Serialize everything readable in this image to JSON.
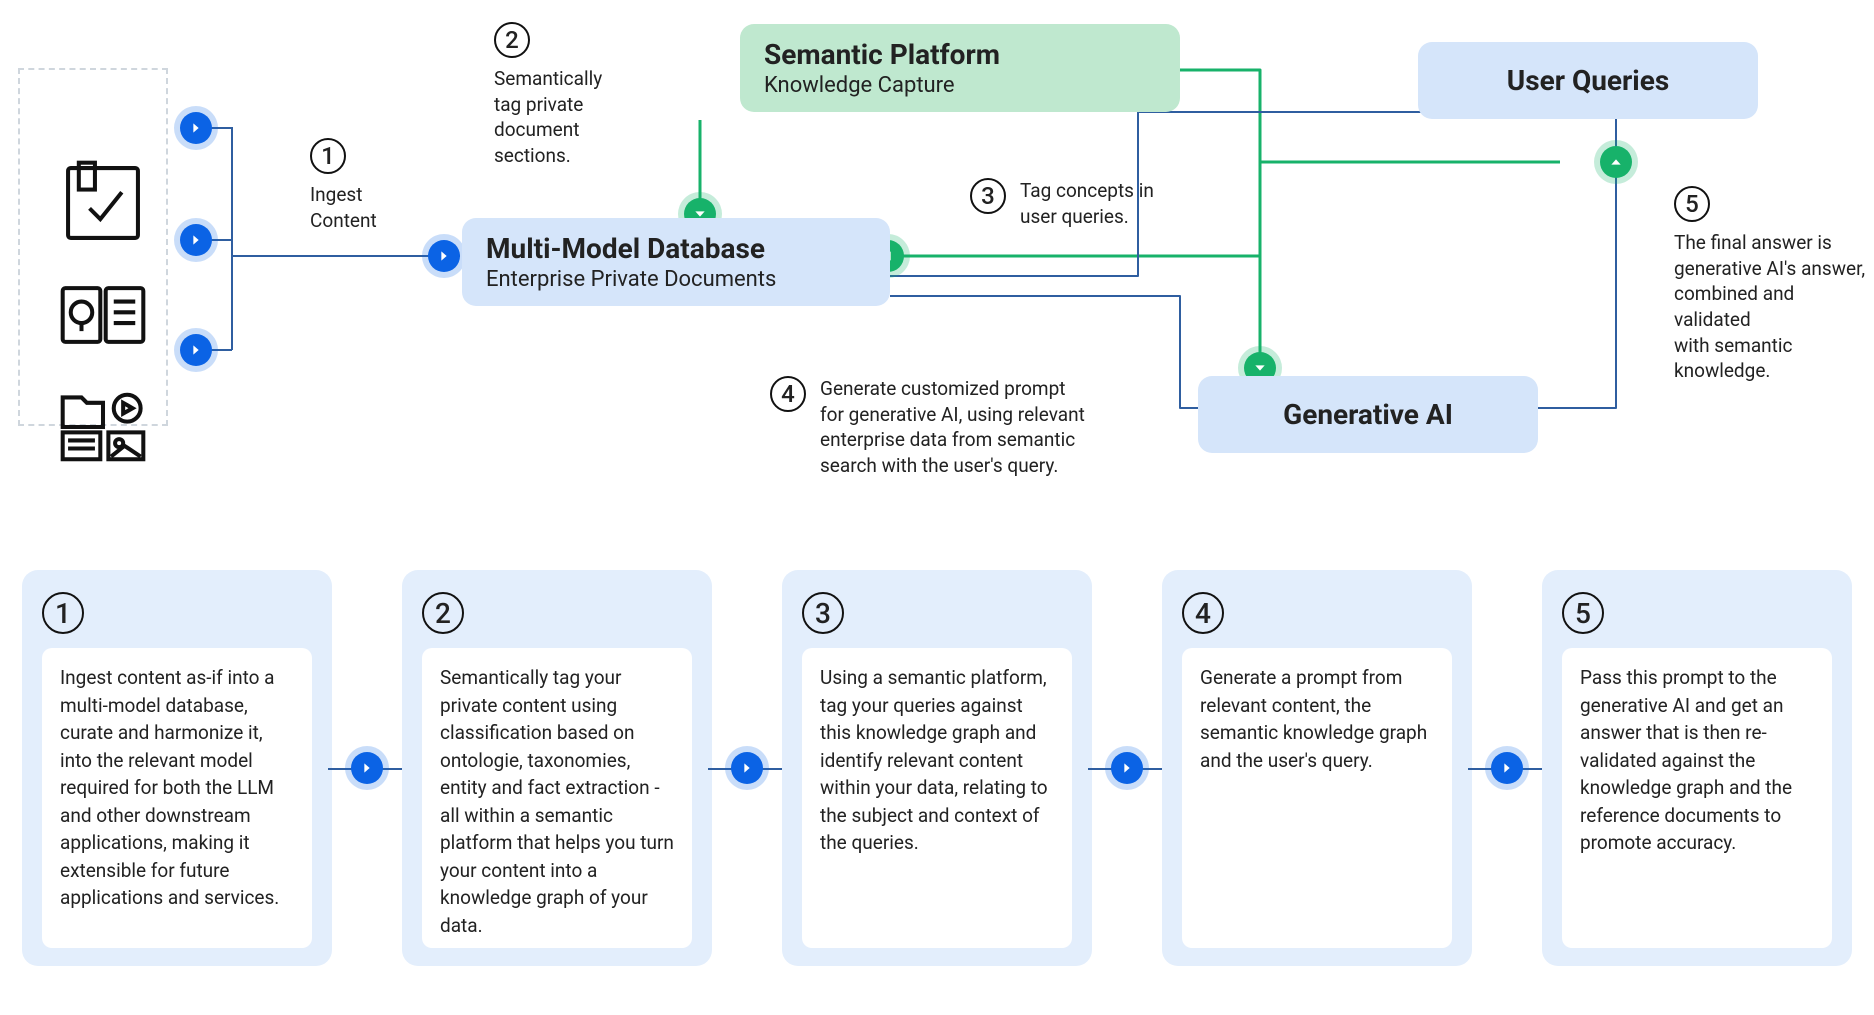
{
  "sources": {
    "label": "content-sources"
  },
  "annotations": {
    "a1": {
      "n": "1",
      "text": "Ingest\nContent"
    },
    "a2": {
      "n": "2",
      "text": "Semantically\ntag private\ndocument\nsections."
    },
    "a3": {
      "n": "3",
      "text": "Tag concepts in\nuser queries."
    },
    "a4": {
      "n": "4",
      "text": "Generate customized prompt\nfor generative AI, using relevant\nenterprise data from semantic\nsearch with the user's query."
    },
    "a5": {
      "n": "5",
      "text": "The final answer is\ngenerative AI's answer,\ncombined and validated\nwith semantic knowledge."
    }
  },
  "nodes": {
    "db": {
      "title": "Multi-Model Database",
      "sub": "Enterprise Private Documents"
    },
    "semantic": {
      "title": "Semantic Platform",
      "sub": "Knowledge Capture"
    },
    "queries": {
      "title": "User Queries"
    },
    "gen": {
      "title": "Generative AI"
    }
  },
  "steps": [
    {
      "n": "1",
      "text": "Ingest content as-if into a multi-model database, curate and harmonize it, into the relevant model required for both the LLM and other downstream applications, making it extensible for future applications and services."
    },
    {
      "n": "2",
      "text": "Semantically tag your private content using classification based on ontologie, taxonomies, entity and fact extraction - all within a semantic platform that helps you turn your content into a knowledge graph of your data."
    },
    {
      "n": "3",
      "text": "Using a semantic platform, tag your queries against this knowledge graph and identify relevant content within your data, relating to the subject and context of the queries."
    },
    {
      "n": "4",
      "text": "Generate a prompt from relevant content, the semantic knowledge graph and the user's query."
    },
    {
      "n": "5",
      "text": "Pass this prompt to the generative AI and get an answer that is then re-validated against the knowledge graph and the reference documents to promote accuracy."
    }
  ]
}
